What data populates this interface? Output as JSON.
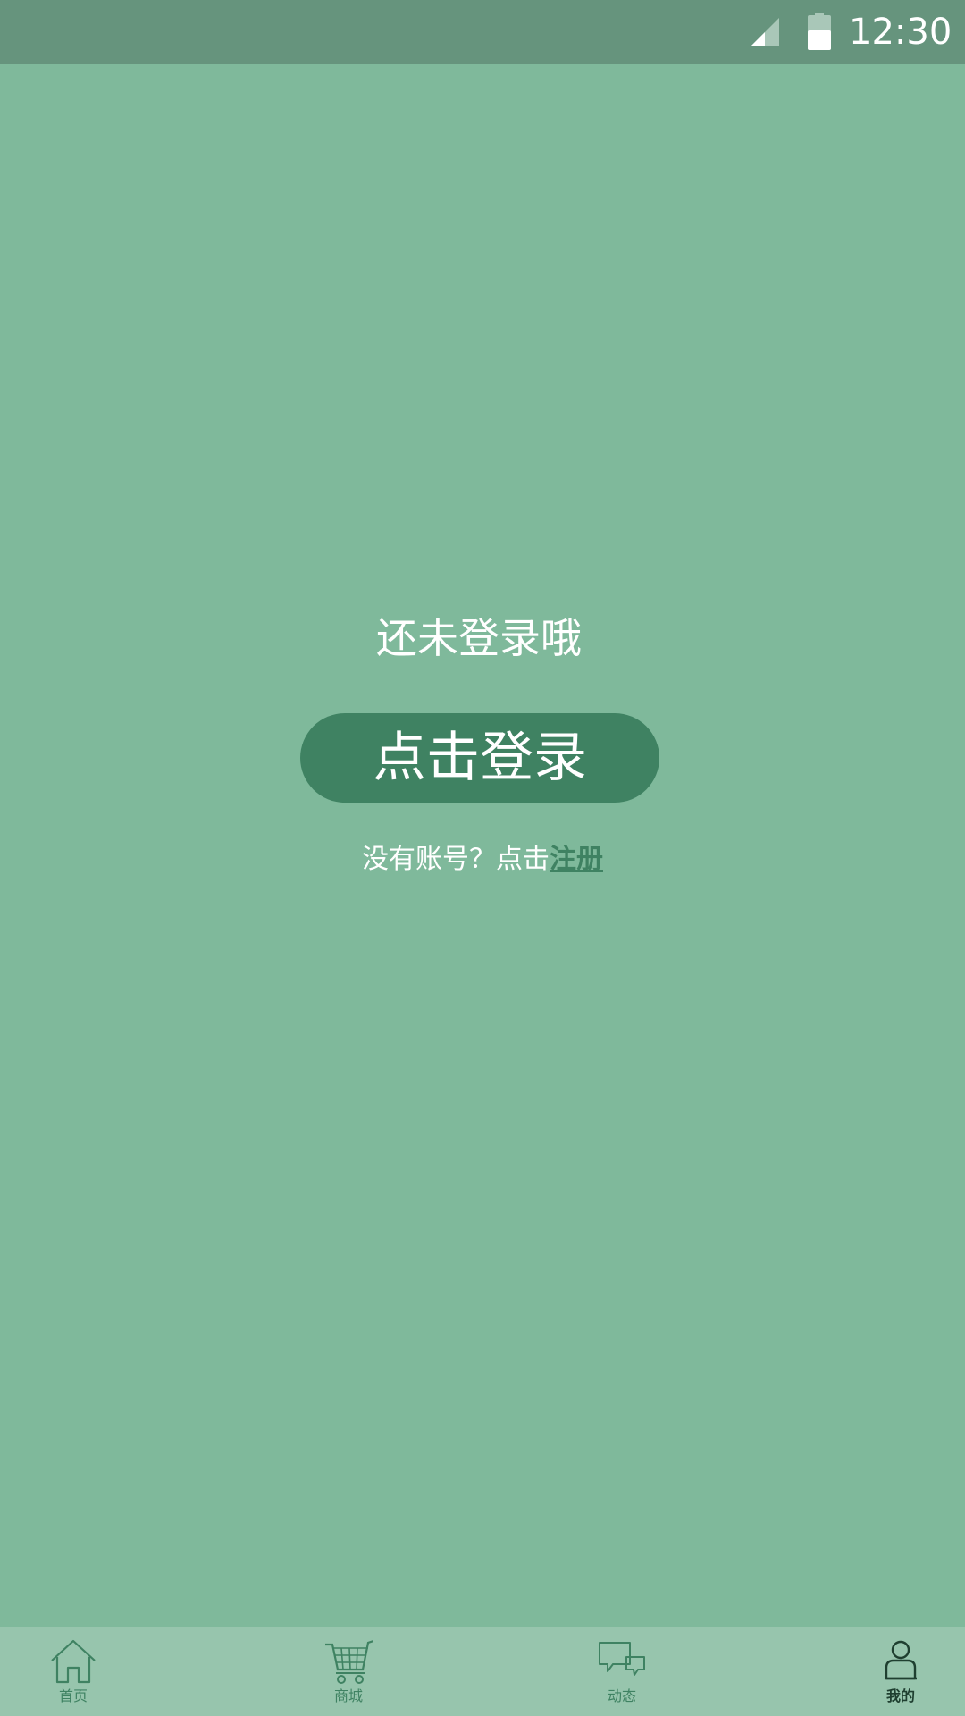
{
  "status_bar": {
    "time": "12:30",
    "signal_icon": "signal-icon",
    "battery_icon": "battery-icon"
  },
  "main": {
    "prompt": "还未登录哦",
    "login_button_label": "点击登录",
    "register_prefix": "没有账号？点击",
    "register_link_label": "注册"
  },
  "tab_bar": {
    "tabs": [
      {
        "label": "首页",
        "icon": "home-icon",
        "active": false
      },
      {
        "label": "商城",
        "icon": "cart-icon",
        "active": false
      },
      {
        "label": "动态",
        "icon": "chat-icon",
        "active": false
      },
      {
        "label": "我的",
        "icon": "user-icon",
        "active": true
      }
    ]
  },
  "colors": {
    "background": "#7fb99b",
    "status_bar": "#66947d",
    "accent": "#3f8262",
    "tab_bar": "#97c5ad",
    "active_tab": "#1f3f30"
  }
}
